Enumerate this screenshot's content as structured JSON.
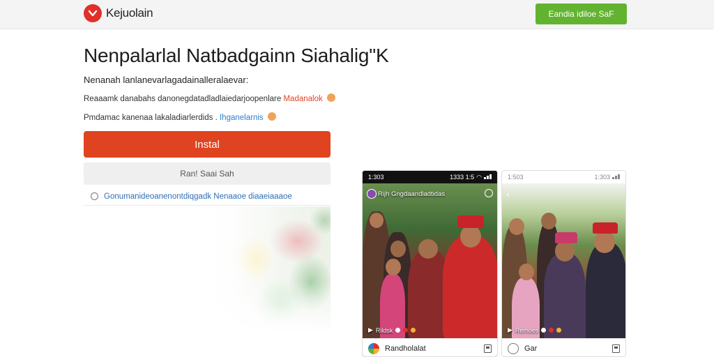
{
  "header": {
    "brand": "Kejuolain",
    "cta_label": "Eandia idiloe SaF",
    "brand_color": "#e0302a",
    "cta_color": "#62b32f"
  },
  "main": {
    "title": "Nenpalarlal Natbadgainn Siahalig\"K",
    "subtitle": "Nenanah lanlanevarlagadainalleralaevar:",
    "info1": {
      "text": "Reaaamk danabahs danonegdatadladlaiedarjoopenlare",
      "link": "Madanalok"
    },
    "info2": {
      "text": "Pmdamac kanenaa lakaladiarlerdids .",
      "link": "Ihganelarnis"
    },
    "install_label": "Instal",
    "install_color": "#e0431f",
    "secondary_label": "Ran! Saai Sah",
    "checkbox_label": "Gonumanideoanenontdiqgadk Nenaaoe diaaeiaaaoe"
  },
  "phones": [
    {
      "time": "1:303",
      "time2": "1333 1:5",
      "scene_title": "Rijh Gngdaandladtidas",
      "caption": "Rildsk",
      "footer_label": "Randholalat"
    },
    {
      "time": "1:503",
      "time2": "1:303",
      "caption": "Remoes",
      "footer_label": "Gar"
    }
  ],
  "icons": {
    "logo": "heart-check-icon",
    "signal": "signal-icon",
    "wifi": "wifi-icon",
    "battery": "battery-icon",
    "back": "back-arrow-icon",
    "save": "save-icon",
    "more": "more-icon"
  }
}
